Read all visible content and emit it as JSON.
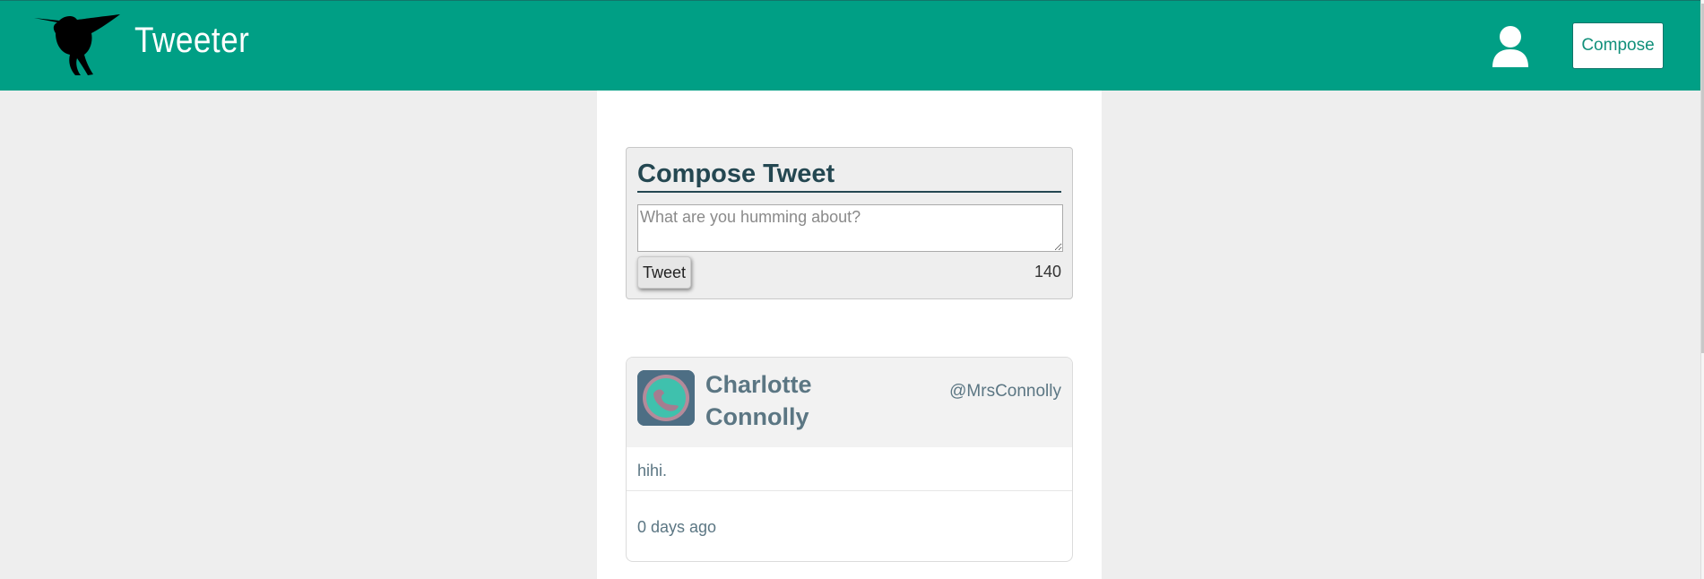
{
  "header": {
    "brand": "Tweeter",
    "compose_label": "Compose",
    "logo_icon": "hummingbird-logo",
    "profile_icon": "user-icon",
    "background_color": "#009f85"
  },
  "compose": {
    "title": "Compose Tweet",
    "placeholder": "What are you humming about?",
    "button_label": "Tweet",
    "char_count": "140"
  },
  "tweets": [
    {
      "author": "Charlotte Connolly",
      "handle": "@MrsConnolly",
      "text": "hihi.",
      "time": "0 days ago",
      "avatar_icon": "avatar-image"
    }
  ]
}
